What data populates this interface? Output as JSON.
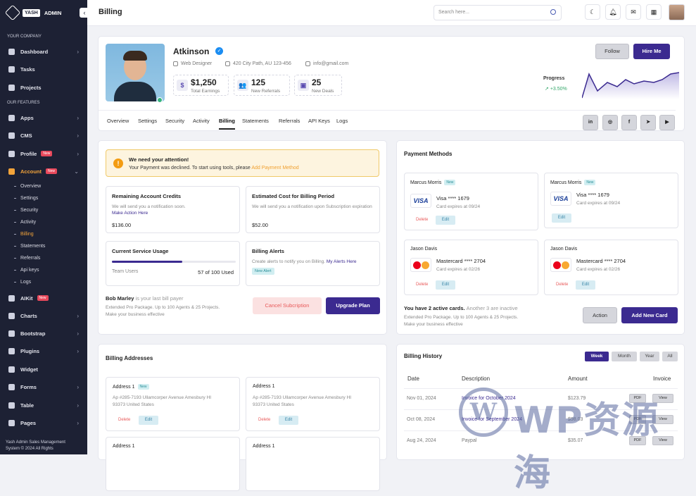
{
  "sidebar": {
    "brand": {
      "badge": "YASH",
      "name": "ADMIN"
    },
    "section_company": "YOUR COMPANY",
    "section_features": "OUR FEATURES",
    "items": [
      {
        "label": "Dashboard",
        "icon": "home-icon"
      },
      {
        "label": "Tasks",
        "icon": "tasks-icon"
      },
      {
        "label": "Projects",
        "icon": "projects-icon"
      },
      {
        "label": "Apps",
        "icon": "apps-icon"
      },
      {
        "label": "CMS",
        "icon": "cms-icon"
      },
      {
        "label": "Profile",
        "icon": "profile-icon",
        "badge": "New"
      },
      {
        "label": "Account",
        "icon": "account-icon",
        "badge": "New"
      },
      {
        "label": "AIKit",
        "icon": "aikit-icon",
        "badge": "New"
      },
      {
        "label": "Charts",
        "icon": "charts-icon"
      },
      {
        "label": "Bootstrap",
        "icon": "bootstrap-icon"
      },
      {
        "label": "Plugins",
        "icon": "plugins-icon"
      },
      {
        "label": "Widget",
        "icon": "widget-icon"
      },
      {
        "label": "Forms",
        "icon": "forms-icon"
      },
      {
        "label": "Table",
        "icon": "table-icon"
      },
      {
        "label": "Pages",
        "icon": "pages-icon"
      }
    ],
    "account_sub": [
      "Overview",
      "Settings",
      "Security",
      "Activity",
      "Billing",
      "Statements",
      "Referrals",
      "Api keys",
      "Logs"
    ],
    "footer_line1": "Yash Admin Sales Management",
    "footer_line2": "System © 2024 All Rights"
  },
  "header": {
    "title": "Billing",
    "search_placeholder": "Search here..."
  },
  "profile": {
    "name": "Atkinson",
    "role": "Web Designer",
    "address": "420 City Path, AU 123-456",
    "email": "info@gmail.com",
    "stats": [
      {
        "value": "$1,250",
        "label": "Total Earnings",
        "icon": "$"
      },
      {
        "value": "125",
        "label": "New Referrals",
        "icon": "👥"
      },
      {
        "value": "25",
        "label": "New Deals",
        "icon": "▣"
      }
    ],
    "follow": "Follow",
    "hire": "Hire Me",
    "progress_label": "Progress",
    "progress_value": "+3.50%",
    "tabs": [
      "Overview",
      "Settings",
      "Security",
      "Activity",
      "Billing",
      "Statements",
      "Referrals",
      "API Keys",
      "Logs"
    ],
    "active_tab": "Billing",
    "social": [
      "in",
      "◎",
      "f",
      "➤",
      "▶"
    ]
  },
  "billing": {
    "alert_title": "We need your attention!",
    "alert_text": "Your Payment was declined. To start using tools, please",
    "alert_link": "Add Payment Method",
    "credits": {
      "title": "Remaining Account Credits",
      "desc": "We will send you a notification soon.",
      "link": "Make Action Here",
      "value": "$136.00"
    },
    "estimated": {
      "title": "Estimated Cost for Billing Period",
      "desc": "We will send you a notification upon Subscription expiration",
      "value": "$52.00"
    },
    "usage": {
      "title": "Current Service Usage",
      "label": "Team Users",
      "value": "57 of 100 Used",
      "fraction": 0.57
    },
    "alerts": {
      "title": "Billing Alerts",
      "desc": "Create alerts to notify you on Billing.",
      "link": "My Alerts Here",
      "tag": "New Alert"
    },
    "payer_name": "Bob Marley",
    "payer_suffix": "is your last bill payer",
    "package_line1": "Extended Pro Package. Up to 100 Agents & 25 Projects.",
    "package_line2": "Make your business effective",
    "cancel": "Cancel Subcription",
    "upgrade": "Upgrade Plan"
  },
  "payment": {
    "title": "Payment Methods",
    "cards": [
      {
        "holder": "Marcus Morris",
        "new": "New",
        "type": "visa",
        "number": "Visa **** 1679",
        "expires": "Card expires at 09/24",
        "delete": "Delete",
        "edit": "Edit"
      },
      {
        "holder": "Marcus Morris",
        "new": "New",
        "type": "visa",
        "number": "Visa **** 1679",
        "expires": "Card expires at 09/24",
        "delete": "",
        "edit": "Edit"
      },
      {
        "holder": "Jason Davis",
        "type": "mastercard",
        "number": "Mastercard **** 2704",
        "expires": "Card expires at 02/26",
        "delete": "Delete",
        "edit": "Edit"
      },
      {
        "holder": "Jason Davis",
        "type": "mastercard",
        "number": "Mastercard **** 2704",
        "expires": "Card expires at 02/26",
        "delete": "Delete",
        "edit": "Edit"
      }
    ],
    "visa_text": "VISA",
    "active_text": "You have 2 active cards.",
    "inactive_text": "Another 3 are inactive",
    "package_line1": "Extended Pro Package. Up to 100 Agents & 25 Projects.",
    "package_line2": "Make your business effective",
    "action": "Action",
    "add": "Add New Card"
  },
  "addresses": {
    "title": "Billing Addresses",
    "items": [
      {
        "name": "Address 1",
        "new": "New",
        "line1": "Ap #285-7193 Ullamcorper Avenue Amesbury HI",
        "line2": "93373 United States",
        "delete": "Delete",
        "edit": "Edit"
      },
      {
        "name": "Address 1",
        "line1": "Ap #285-7193 Ullamcorper Avenue Amesbury HI",
        "line2": "93373 United States",
        "delete": "Delete",
        "edit": "Edit"
      },
      {
        "name": "Address 1"
      },
      {
        "name": "Address 1"
      }
    ]
  },
  "history": {
    "title": "Billing History",
    "periods": [
      "Week",
      "Month",
      "Year",
      "All"
    ],
    "columns": [
      "Date",
      "Description",
      "Amount",
      "Invoice"
    ],
    "rows": [
      {
        "date": "Nov 01, 2024",
        "desc": "Invoice for October 2024",
        "amount": "$123.79",
        "pdf": "PDF",
        "view": "View"
      },
      {
        "date": "Oct 08, 2024",
        "desc": "Invoice for September 2024",
        "amount": "$98.03",
        "pdf": "PDF",
        "view": "View"
      },
      {
        "date": "Aug 24, 2024",
        "desc": "Paypal",
        "amount": "$35.07",
        "pdf": "PDF",
        "view": "View"
      }
    ]
  },
  "watermark": {
    "mark": "W",
    "text": "WP资源海"
  },
  "colors": {
    "primary": "#3b2a90",
    "sidebar": "#1d2134",
    "active": "#f2a33a",
    "danger": "#e85a5a"
  }
}
